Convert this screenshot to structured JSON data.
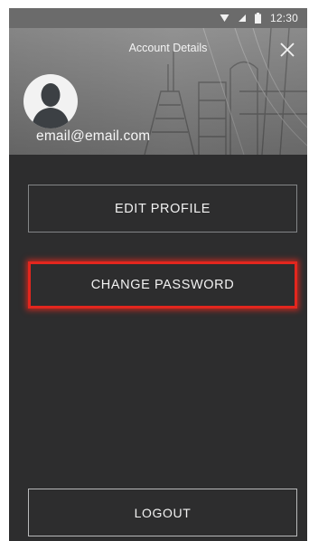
{
  "status_bar": {
    "time": "12:30",
    "icons": [
      "wifi-icon",
      "signal-icon",
      "battery-icon"
    ]
  },
  "header": {
    "title": "Account Details",
    "close_icon": "close-icon",
    "avatar_icon": "user-avatar-icon",
    "email": "email@email.com"
  },
  "actions": {
    "edit_profile": "EDIT PROFILE",
    "change_password": "CHANGE PASSWORD",
    "logout": "LOGOUT"
  },
  "colors": {
    "background": "#2d2d2e",
    "button_border": "#838587",
    "highlight": "#e3261e"
  }
}
